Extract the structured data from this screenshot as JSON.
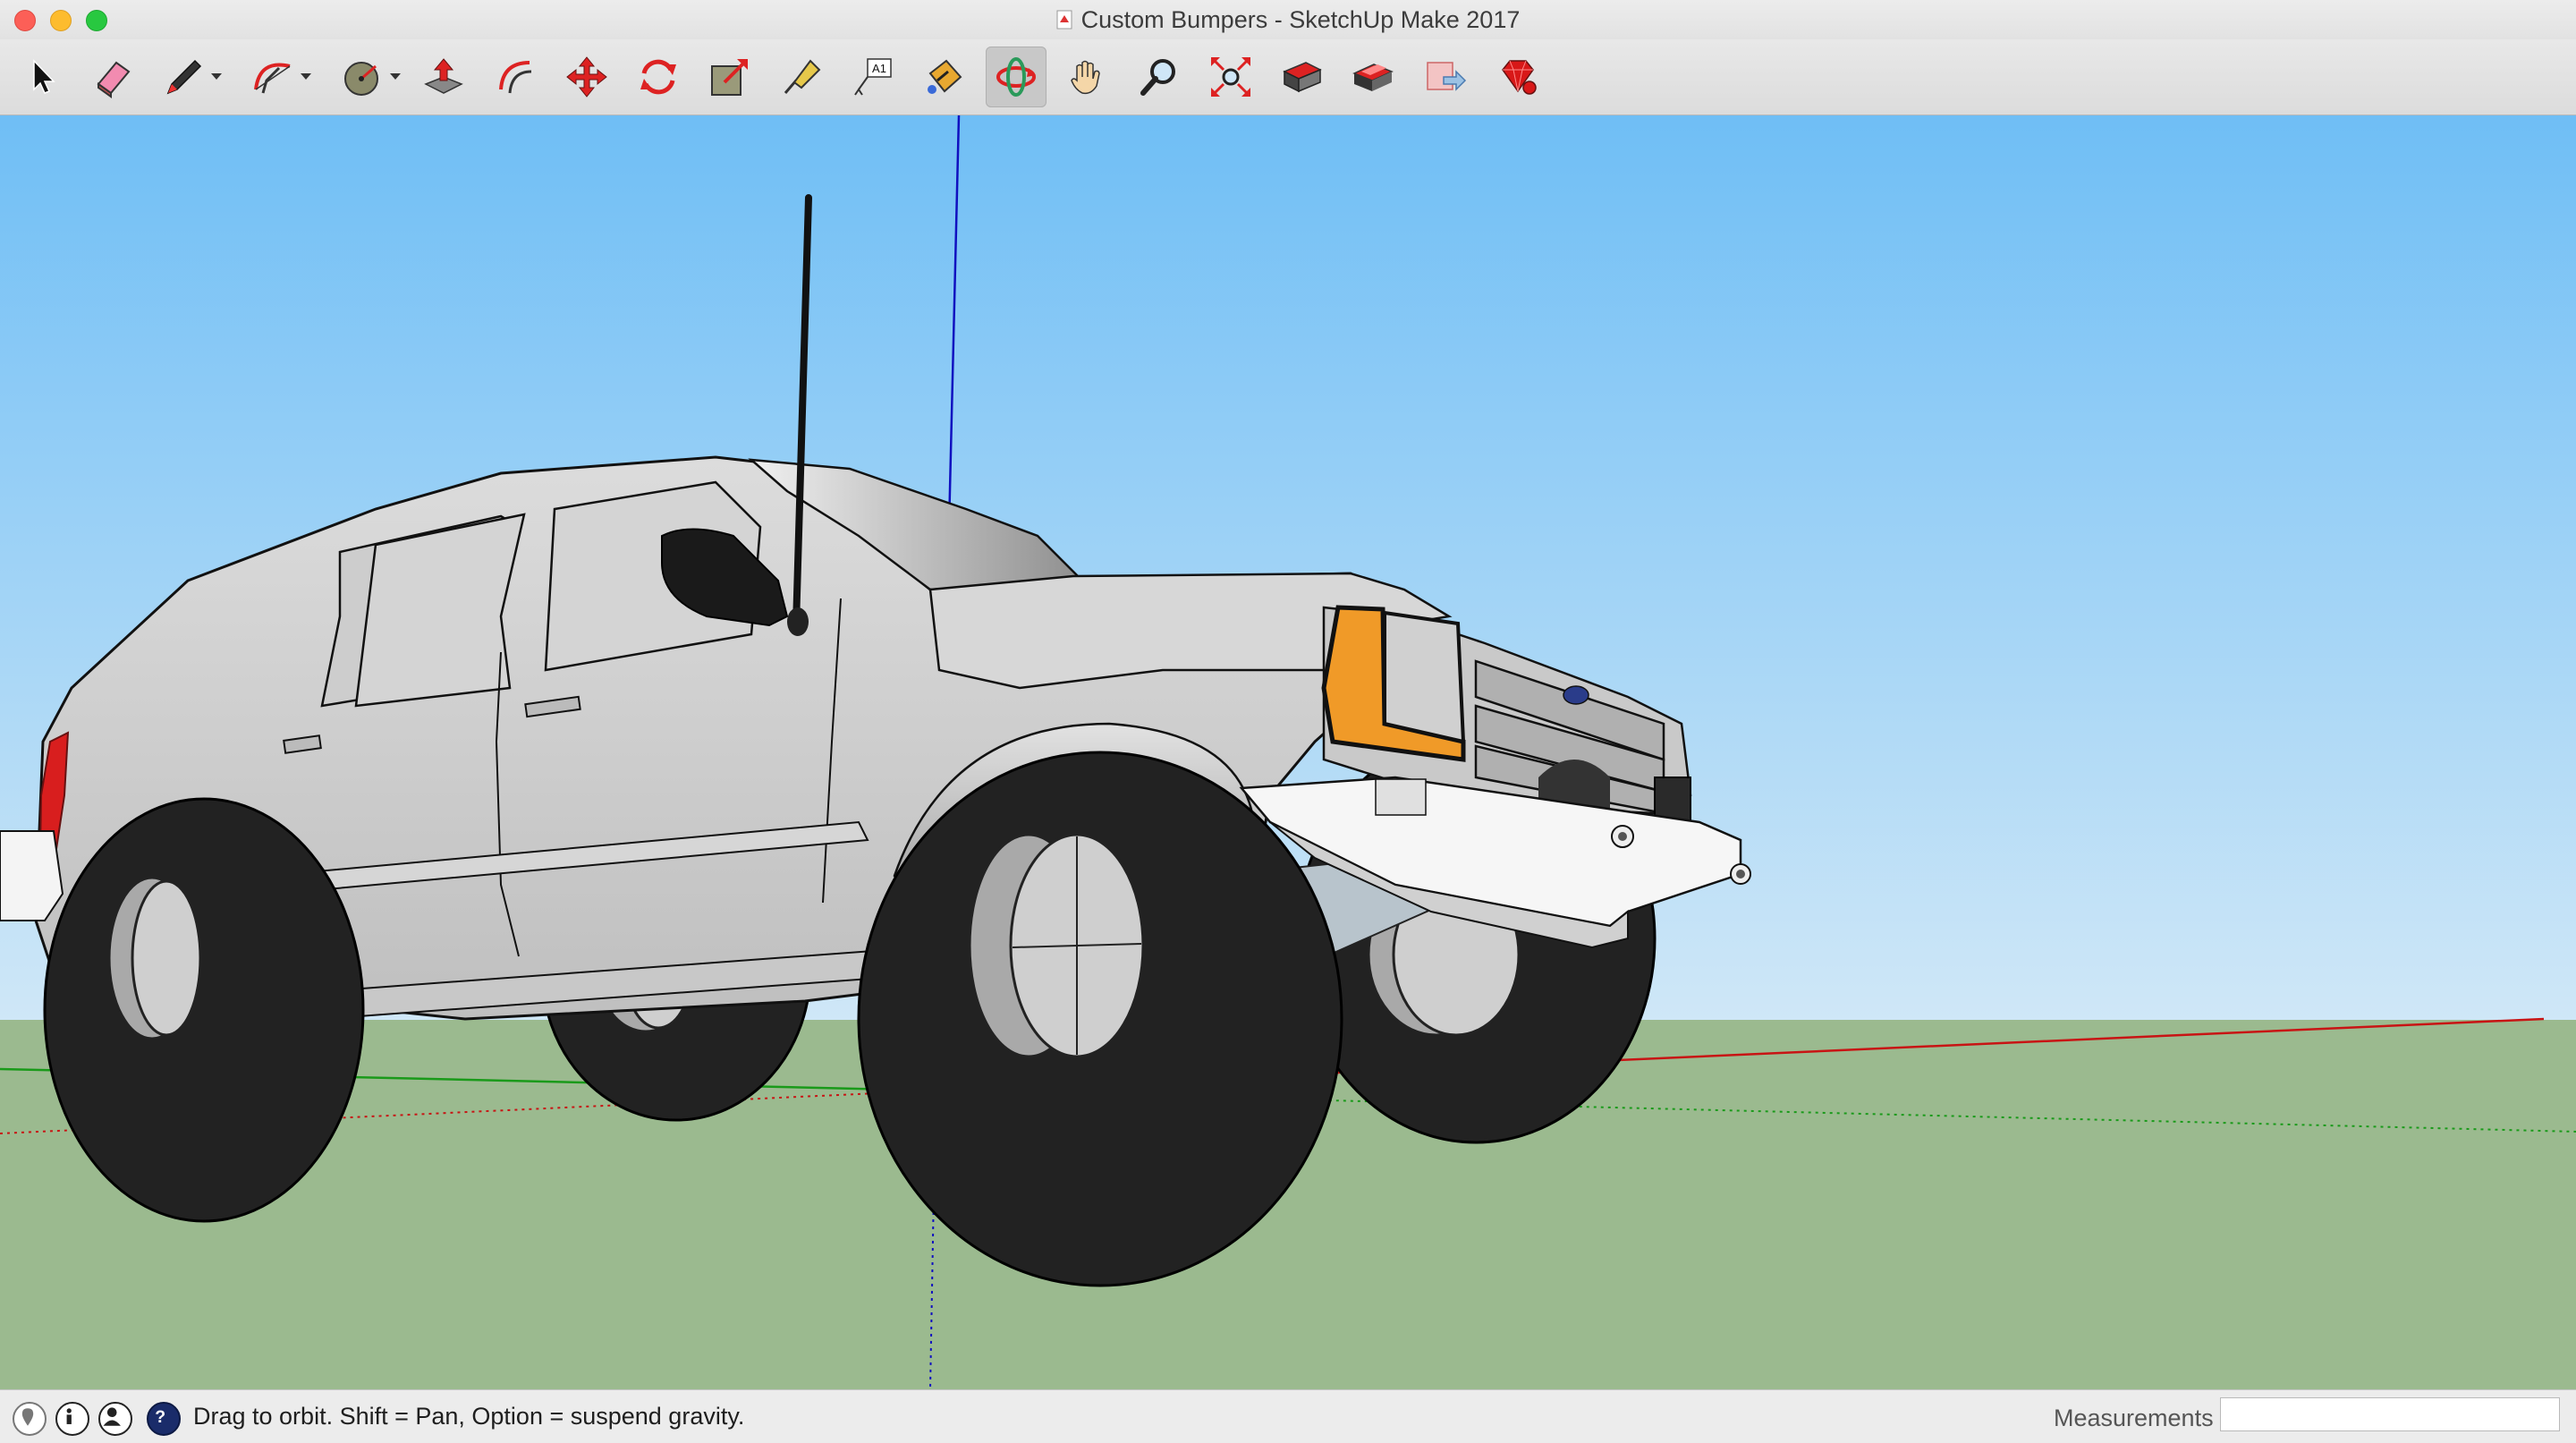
{
  "window": {
    "title": "Custom Bumpers - SketchUp Make 2017"
  },
  "toolbar": {
    "tools": [
      {
        "name": "select-tool",
        "icon": "arrow-cursor-icon"
      },
      {
        "name": "eraser-tool",
        "icon": "eraser-icon"
      },
      {
        "name": "line-tool",
        "icon": "pencil-icon",
        "dropdown": true
      },
      {
        "name": "arc-tool",
        "icon": "arc-icon",
        "dropdown": true
      },
      {
        "name": "shapes-tool",
        "icon": "circle-shape-icon",
        "dropdown": true
      },
      {
        "name": "push-pull-tool",
        "icon": "push-pull-icon"
      },
      {
        "name": "offset-tool",
        "icon": "offset-icon"
      },
      {
        "name": "move-tool",
        "icon": "move-arrows-icon"
      },
      {
        "name": "rotate-tool",
        "icon": "rotate-icon"
      },
      {
        "name": "scale-tool",
        "icon": "scale-icon"
      },
      {
        "name": "tape-measure-tool",
        "icon": "tape-measure-icon"
      },
      {
        "name": "text-tool",
        "icon": "text-label-icon"
      },
      {
        "name": "paint-bucket-tool",
        "icon": "paint-bucket-icon"
      },
      {
        "name": "orbit-tool",
        "icon": "orbit-icon",
        "active": true
      },
      {
        "name": "pan-tool",
        "icon": "hand-icon"
      },
      {
        "name": "zoom-tool",
        "icon": "magnifier-icon"
      },
      {
        "name": "zoom-extents-tool",
        "icon": "zoom-extents-icon"
      },
      {
        "name": "3d-warehouse-tool",
        "icon": "warehouse-icon"
      },
      {
        "name": "share-component-tool",
        "icon": "share-component-icon"
      },
      {
        "name": "share-model-tool",
        "icon": "share-model-icon"
      },
      {
        "name": "extension-warehouse-tool",
        "icon": "ruby-gem-icon"
      }
    ],
    "title_text_icon_label": "A1"
  },
  "colors": {
    "sky_top": "#6fbef5",
    "sky_bottom": "#cfe7f7",
    "ground": "#9bba8f",
    "axis_red": "#c81414",
    "axis_green": "#1a9a1a",
    "axis_blue": "#1010c0",
    "body": "#cfcfcf",
    "tire": "#222222",
    "headlight_amber": "#f09a28"
  },
  "statusbar": {
    "hint": "Drag to orbit. Shift = Pan, Option = suspend gravity.",
    "measurements_label": "Measurements",
    "measurements_value": ""
  }
}
